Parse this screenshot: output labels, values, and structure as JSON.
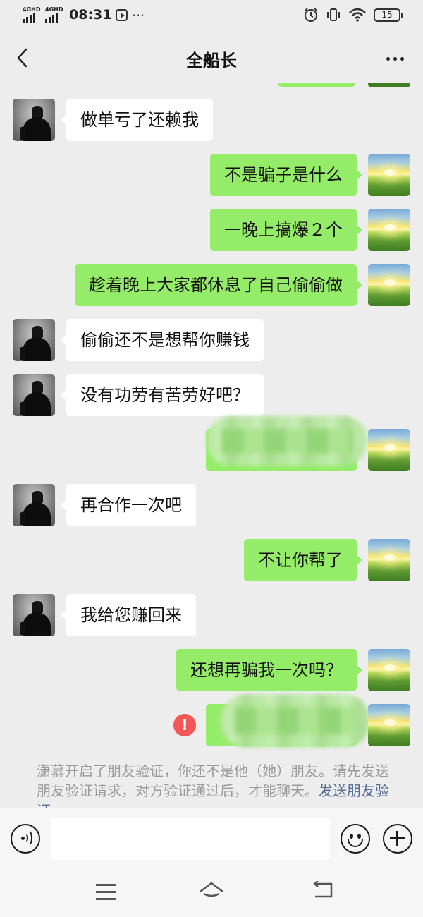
{
  "status_bar": {
    "network_1": "4GHD",
    "network_2": "4GHD",
    "time": "08:31",
    "more_dots": "···",
    "battery": "15",
    "icons": [
      "alarm-icon",
      "vibrate-icon",
      "wifi-icon",
      "battery-icon"
    ]
  },
  "nav": {
    "title": "全船长"
  },
  "messages": [
    {
      "side": "in",
      "text": "做单亏了还赖我"
    },
    {
      "side": "out",
      "text": "不是骗子是什么"
    },
    {
      "side": "out",
      "text": "一晚上搞爆２个"
    },
    {
      "side": "out",
      "text": "趁着晚上大家都休息了自己偷偷做"
    },
    {
      "side": "in",
      "text": "偷偷还不是想帮你赚钱"
    },
    {
      "side": "in",
      "text": "没有功劳有苦劳好吧？"
    },
    {
      "side": "out",
      "text": "",
      "redacted": true
    },
    {
      "side": "in",
      "text": "再合作一次吧"
    },
    {
      "side": "out",
      "text": "不让你帮了"
    },
    {
      "side": "in",
      "text": "我给您赚回来"
    },
    {
      "side": "out",
      "text": "还想再骗我一次吗？"
    },
    {
      "side": "out",
      "text": "",
      "redacted": true,
      "failed": true
    }
  ],
  "failed_mark": "!",
  "system_notice": {
    "text": "潇慕开启了朋友验证，你还不是他（她）朋友。请先发送朋友验证请求，对方验证通过后，才能聊天。",
    "link": "发送朋友验证"
  },
  "colors": {
    "background": "#ededed",
    "outgoing_bubble": "#95ec69",
    "incoming_bubble": "#ffffff",
    "link": "#576b95",
    "fail": "#f25757"
  }
}
